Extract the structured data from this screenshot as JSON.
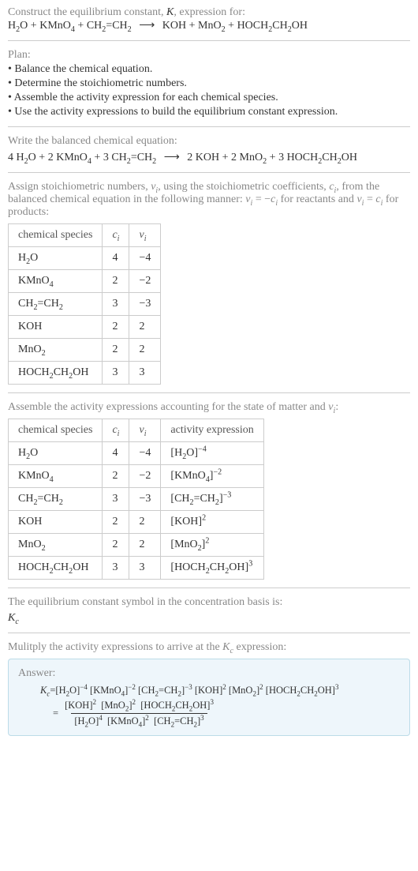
{
  "intro": {
    "prompt_line1": "Construct the equilibrium constant, ",
    "K": "K",
    "prompt_line1b": ", expression for:"
  },
  "unbalanced": {
    "H2O": "H",
    "H2O_2": "2",
    "H2O_O": "O",
    "plus": " + ",
    "KMnO4_K": "KMnO",
    "KMnO4_4": "4",
    "CH2CH2_a": "CH",
    "CH2CH2_2": "2",
    "CH2CH2_eq": "=CH",
    "CH2CH2_2b": "2",
    "arrow": "⟶",
    "KOH": "KOH",
    "MnO2_Mn": "MnO",
    "MnO2_2": "2",
    "HO_a": "HOCH",
    "HO_2": "2",
    "HO_b": "CH",
    "HO_2b": "2",
    "HO_c": "OH"
  },
  "plan": {
    "title": "Plan:",
    "items": [
      "• Balance the chemical equation.",
      "• Determine the stoichiometric numbers.",
      "• Assemble the activity expression for each chemical species.",
      "• Use the activity expressions to build the equilibrium constant expression."
    ]
  },
  "balanced": {
    "prompt": "Write the balanced chemical equation:",
    "c1": "4 ",
    "c2": "2 ",
    "c3": "3 ",
    "c4": "2 ",
    "c5": "2 ",
    "c6": "3 "
  },
  "assign": {
    "text1": "Assign stoichiometric numbers, ",
    "nu": "ν",
    "i": "i",
    "text2": ", using the stoichiometric coefficients, ",
    "c": "c",
    "text3": ", from the balanced chemical equation in the following manner: ",
    "eq1a": "ν",
    "eq1b": " = −",
    "eq1c": "c",
    "text4": " for reactants and ",
    "eq2a": "ν",
    "eq2b": " = ",
    "eq2c": "c",
    "text5": " for products:"
  },
  "table1": {
    "headers": {
      "species": "chemical species",
      "ci": "c",
      "ci_i": "i",
      "nui": "ν",
      "nui_i": "i"
    },
    "rows": [
      {
        "ci": "4",
        "nui": "−4"
      },
      {
        "ci": "2",
        "nui": "−2"
      },
      {
        "ci": "3",
        "nui": "−3"
      },
      {
        "ci": "2",
        "nui": "2"
      },
      {
        "ci": "2",
        "nui": "2"
      },
      {
        "ci": "3",
        "nui": "3"
      }
    ]
  },
  "assemble_text": "Assemble the activity expressions accounting for the state of matter and ",
  "assemble_nu": "ν",
  "assemble_i": "i",
  "assemble_colon": ":",
  "table2": {
    "headers": {
      "species": "chemical species",
      "ci": "c",
      "ci_i": "i",
      "nui": "ν",
      "nui_i": "i",
      "act": "activity expression"
    },
    "rows": [
      {
        "ci": "4",
        "nui": "−4",
        "exp": "−4"
      },
      {
        "ci": "2",
        "nui": "−2",
        "exp": "−2"
      },
      {
        "ci": "3",
        "nui": "−3",
        "exp": "−3"
      },
      {
        "ci": "2",
        "nui": "2",
        "exp": "2"
      },
      {
        "ci": "2",
        "nui": "2",
        "exp": "2"
      },
      {
        "ci": "3",
        "nui": "3",
        "exp": "3"
      }
    ]
  },
  "kc_text": "The equilibrium constant symbol in the concentration basis is:",
  "kc_sym_K": "K",
  "kc_sym_c": "c",
  "mult_text": "Mulitply the activity expressions to arrive at the ",
  "mult_text2": " expression:",
  "answer_label": "Answer:",
  "ans": {
    "Kc_eq": " = ",
    "eq": " = ",
    "e_m4": "−4",
    "e_m2": "−2",
    "e_m3": "−3",
    "e_2": "2",
    "e_3": "3",
    "e_4": "4"
  },
  "chart_data": {
    "type": "table",
    "title": "Stoichiometric numbers",
    "species": [
      "H2O",
      "KMnO4",
      "CH2=CH2",
      "KOH",
      "MnO2",
      "HOCH2CH2OH"
    ],
    "c_i": [
      4,
      2,
      3,
      2,
      2,
      3
    ],
    "nu_i": [
      -4,
      -2,
      -3,
      2,
      2,
      3
    ]
  }
}
